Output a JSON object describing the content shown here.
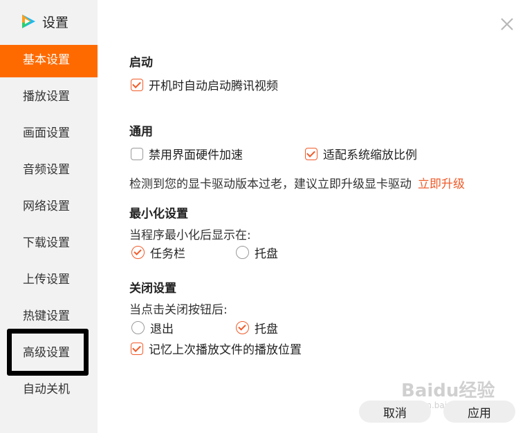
{
  "app": {
    "title": "设置",
    "logo_icon": "tencent-video-logo-icon"
  },
  "sidebar": {
    "items": [
      {
        "label": "基本设置",
        "active": true
      },
      {
        "label": "播放设置"
      },
      {
        "label": "画面设置"
      },
      {
        "label": "音频设置"
      },
      {
        "label": "网络设置"
      },
      {
        "label": "下载设置"
      },
      {
        "label": "上传设置"
      },
      {
        "label": "热键设置"
      },
      {
        "label": "高级设置",
        "highlighted": true
      },
      {
        "label": "自动关机"
      }
    ]
  },
  "window": {
    "close_icon": "close-icon"
  },
  "startup": {
    "title": "启动",
    "auto_start_label": "开机时自动启动腾讯视频",
    "auto_start_checked": true
  },
  "general": {
    "title": "通用",
    "disable_hw_accel_label": "禁用界面硬件加速",
    "disable_hw_accel_checked": false,
    "fit_scale_label": "适配系统缩放比例",
    "fit_scale_checked": true,
    "driver_notice": "检测到您的显卡驱动版本过老，建议立即升级显卡驱动",
    "upgrade_link": "立即升级"
  },
  "minimize": {
    "title": "最小化设置",
    "prompt": "当程序最小化后显示在:",
    "option_taskbar": "任务栏",
    "option_tray": "托盘",
    "selected": "任务栏"
  },
  "close_settings": {
    "title": "关闭设置",
    "prompt": "当点击关闭按钮后:",
    "option_exit": "退出",
    "option_tray": "托盘",
    "selected": "托盘",
    "remember_label": "记忆上次播放文件的播放位置",
    "remember_checked": true
  },
  "footer": {
    "cancel_label": "取消",
    "apply_label": "应用"
  },
  "watermark": {
    "text": "Baidu经验",
    "sub": "jingyan.baidu.com"
  },
  "colors": {
    "accent": "#ff6a00",
    "check": "#f05a28",
    "sidebar_bg": "#f2f2f2"
  }
}
